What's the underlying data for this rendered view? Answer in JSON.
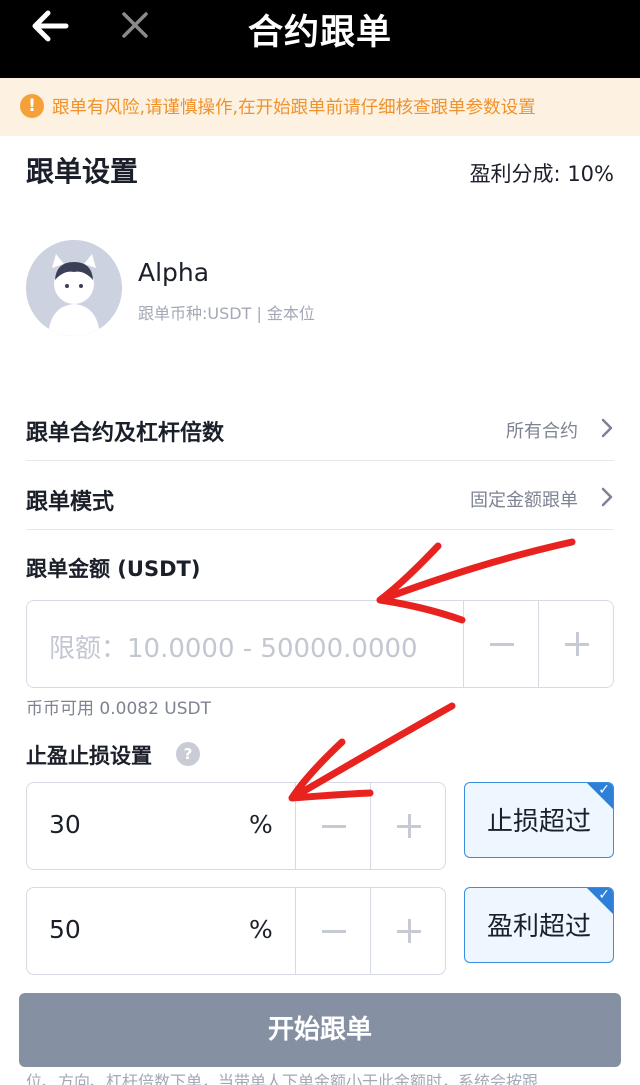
{
  "header": {
    "title": "合约跟单"
  },
  "warning": {
    "text": "跟单有风险,请谨慎操作,在开始跟单前请仔细核查跟单参数设置"
  },
  "settings": {
    "title": "跟单设置",
    "profit_share": "盈利分成: 10%"
  },
  "trader": {
    "name": "Alpha",
    "subtitle": "跟单币种:USDT | 金本位"
  },
  "rows": [
    {
      "label": "跟单合约及杠杆倍数",
      "value": "所有合约"
    },
    {
      "label": "跟单模式",
      "value": "固定金额跟单"
    }
  ],
  "amount": {
    "label": "跟单金额 (USDT)",
    "placeholder": "限额：10.0000 - 50000.0000",
    "available": "币币可用 0.0082 USDT"
  },
  "tpsl": {
    "label": "止盈止损设置",
    "stop_loss": {
      "value": "30",
      "unit": "%",
      "toggle_label": "止损超过"
    },
    "take_profit": {
      "value": "50",
      "unit": "%",
      "toggle_label": "盈利超过"
    }
  },
  "actions": {
    "start_label": "开始跟单"
  },
  "footer": {
    "text": "位、方向、杠杆倍数下单，当带单人下单金额小于此金额时，系统会按跟"
  },
  "colors": {
    "header_bg": "#000000",
    "warning_bg": "#fdf1e2",
    "warning_text": "#f0922b",
    "accent": "#2e7fd8",
    "button_bg": "#8590a3",
    "annotation": "#e8231f"
  }
}
